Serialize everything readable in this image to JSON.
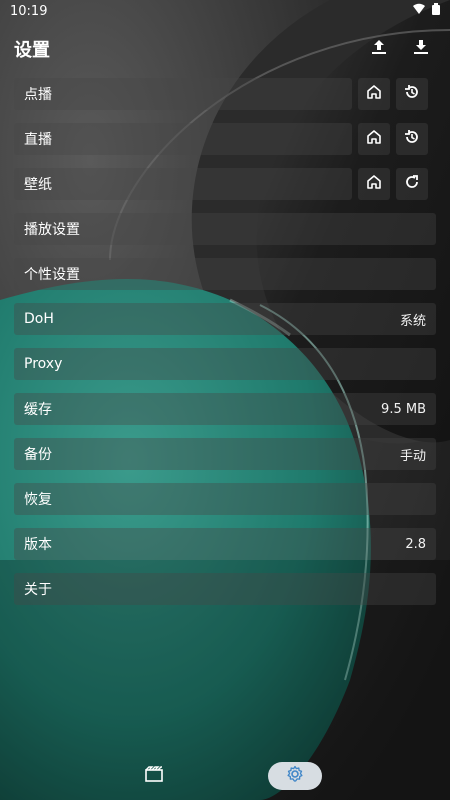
{
  "status_bar": {
    "time": "10:19",
    "icons": [
      "wifi-icon",
      "battery-icon"
    ]
  },
  "header": {
    "title": "设置",
    "actions": [
      {
        "name": "upload-icon"
      },
      {
        "name": "download-icon"
      }
    ]
  },
  "settings": {
    "vod": {
      "label": "点播",
      "icons": [
        "home-icon",
        "history-icon"
      ]
    },
    "live": {
      "label": "直播",
      "icons": [
        "home-icon",
        "history-icon"
      ]
    },
    "wallpaper": {
      "label": "壁纸",
      "icons": [
        "home-icon",
        "refresh-icon"
      ]
    },
    "player": {
      "label": "播放设置"
    },
    "personal": {
      "label": "个性设置"
    },
    "doh": {
      "label": "DoH",
      "value": "系统"
    },
    "proxy": {
      "label": "Proxy"
    },
    "cache": {
      "label": "缓存",
      "value": "9.5 MB"
    },
    "backup": {
      "label": "备份",
      "value": "手动"
    },
    "restore": {
      "label": "恢复"
    },
    "version": {
      "label": "版本",
      "value": "2.8"
    },
    "about": {
      "label": "关于"
    }
  },
  "bottom_nav": {
    "items": [
      {
        "name": "film-icon",
        "active": false
      },
      {
        "name": "settings-icon",
        "active": true
      }
    ],
    "active_color": "#3f86c8"
  },
  "colors": {
    "accent_teal": "#1f7a6c",
    "background": "#1b1b1b"
  }
}
